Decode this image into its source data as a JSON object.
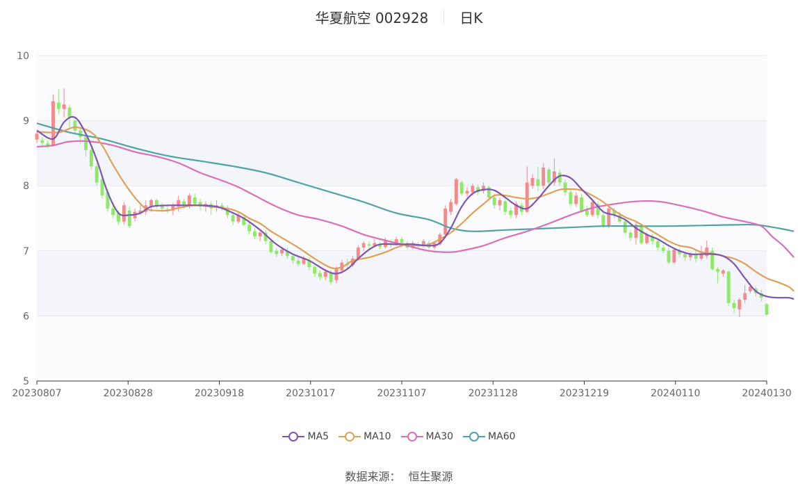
{
  "header": {
    "title": "华夏航空 002928",
    "period": "日K"
  },
  "legend_title": "",
  "source": {
    "label": "数据来源：",
    "value": "恒生聚源"
  },
  "colors": {
    "up": "#f28b8b",
    "down": "#8fe86a",
    "MA5": "#7b55b0",
    "MA10": "#e0a057",
    "MA30": "#d86fb8",
    "MA60": "#4fa3a5",
    "band": "#f3f5fa",
    "grid": "#e4e8f0"
  },
  "chart_data": {
    "type": "candlestick",
    "ylim": [
      5,
      10
    ],
    "yticks": [
      "5",
      "6",
      "7",
      "8",
      "9",
      "10"
    ],
    "x_tick_labels": [
      "20230807",
      "20230828",
      "20230918",
      "20231017",
      "20231107",
      "20231128",
      "20231219",
      "20240110",
      "20240130"
    ],
    "legend": [
      "MA5",
      "MA10",
      "MA30",
      "MA60"
    ],
    "candles": [
      [
        8.71,
        8.8,
        8.66,
        8.84
      ],
      [
        8.7,
        8.66,
        8.62,
        8.75
      ],
      [
        8.65,
        8.62,
        8.58,
        8.7
      ],
      [
        8.62,
        9.3,
        8.6,
        9.4
      ],
      [
        9.28,
        9.18,
        9.1,
        9.48
      ],
      [
        9.18,
        9.25,
        9.05,
        9.5
      ],
      [
        9.2,
        9.05,
        8.9,
        9.25
      ],
      [
        9.0,
        8.85,
        8.8,
        9.05
      ],
      [
        8.85,
        8.75,
        8.65,
        8.9
      ],
      [
        8.75,
        8.55,
        8.45,
        8.8
      ],
      [
        8.55,
        8.3,
        8.25,
        8.6
      ],
      [
        8.3,
        8.05,
        8.0,
        8.35
      ],
      [
        8.1,
        7.85,
        7.8,
        8.15
      ],
      [
        7.9,
        7.65,
        7.6,
        7.95
      ],
      [
        7.65,
        7.55,
        7.5,
        7.7
      ],
      [
        7.58,
        7.45,
        7.4,
        7.62
      ],
      [
        7.45,
        7.7,
        7.4,
        7.75
      ],
      [
        7.62,
        7.38,
        7.35,
        7.68
      ],
      [
        7.5,
        7.6,
        7.45,
        7.65
      ],
      [
        7.58,
        7.62,
        7.55,
        7.7
      ],
      [
        7.6,
        7.7,
        7.55,
        7.78
      ],
      [
        7.68,
        7.78,
        7.6,
        7.8
      ],
      [
        7.78,
        7.68,
        7.65,
        7.8
      ],
      [
        7.7,
        7.65,
        7.6,
        7.74
      ],
      [
        7.64,
        7.62,
        7.58,
        7.7
      ],
      [
        7.62,
        7.7,
        7.55,
        7.74
      ],
      [
        7.68,
        7.78,
        7.6,
        7.85
      ],
      [
        7.76,
        7.7,
        7.65,
        7.8
      ],
      [
        7.7,
        7.85,
        7.65,
        7.88
      ],
      [
        7.82,
        7.72,
        7.68,
        7.88
      ],
      [
        7.75,
        7.68,
        7.62,
        7.8
      ],
      [
        7.68,
        7.72,
        7.6,
        7.76
      ],
      [
        7.72,
        7.65,
        7.55,
        7.76
      ],
      [
        7.66,
        7.7,
        7.6,
        7.78
      ],
      [
        7.7,
        7.66,
        7.62,
        7.74
      ],
      [
        7.66,
        7.55,
        7.5,
        7.7
      ],
      [
        7.55,
        7.45,
        7.4,
        7.6
      ],
      [
        7.45,
        7.55,
        7.42,
        7.6
      ],
      [
        7.52,
        7.4,
        7.38,
        7.56
      ],
      [
        7.4,
        7.3,
        7.25,
        7.45
      ],
      [
        7.3,
        7.22,
        7.18,
        7.35
      ],
      [
        7.22,
        7.28,
        7.15,
        7.32
      ],
      [
        7.28,
        7.15,
        7.1,
        7.32
      ],
      [
        7.15,
        6.98,
        6.95,
        7.18
      ],
      [
        7.0,
        6.95,
        6.9,
        7.05
      ],
      [
        6.96,
        7.02,
        6.92,
        7.06
      ],
      [
        7.0,
        6.92,
        6.88,
        7.05
      ],
      [
        6.92,
        6.85,
        6.8,
        6.95
      ],
      [
        6.85,
        6.8,
        6.76,
        6.9
      ],
      [
        6.8,
        6.88,
        6.78,
        6.92
      ],
      [
        6.86,
        6.75,
        6.7,
        6.9
      ],
      [
        6.75,
        6.65,
        6.6,
        6.78
      ],
      [
        6.66,
        6.6,
        6.55,
        6.7
      ],
      [
        6.6,
        6.68,
        6.55,
        6.72
      ],
      [
        6.66,
        6.52,
        6.48,
        6.7
      ],
      [
        6.55,
        6.72,
        6.5,
        6.76
      ],
      [
        6.7,
        6.82,
        6.65,
        6.86
      ],
      [
        6.8,
        6.78,
        6.72,
        6.88
      ],
      [
        6.78,
        6.88,
        6.75,
        6.92
      ],
      [
        6.88,
        7.05,
        6.85,
        7.08
      ],
      [
        7.05,
        7.12,
        7.0,
        7.15
      ],
      [
        7.1,
        7.08,
        7.02,
        7.15
      ],
      [
        7.08,
        7.12,
        7.05,
        7.18
      ],
      [
        7.1,
        7.06,
        7.02,
        7.14
      ],
      [
        7.06,
        7.15,
        7.04,
        7.2
      ],
      [
        7.12,
        7.1,
        7.05,
        7.18
      ],
      [
        7.1,
        7.18,
        7.08,
        7.22
      ],
      [
        7.18,
        7.12,
        7.08,
        7.22
      ],
      [
        7.12,
        7.05,
        7.02,
        7.15
      ],
      [
        7.05,
        7.12,
        7.02,
        7.15
      ],
      [
        7.1,
        7.08,
        7.04,
        7.14
      ],
      [
        7.08,
        7.15,
        7.05,
        7.18
      ],
      [
        7.12,
        7.05,
        7.02,
        7.16
      ],
      [
        7.05,
        7.12,
        7.02,
        7.15
      ],
      [
        7.1,
        7.25,
        7.08,
        7.28
      ],
      [
        7.25,
        7.65,
        7.2,
        7.7
      ],
      [
        7.6,
        7.75,
        7.55,
        7.8
      ],
      [
        7.72,
        8.1,
        7.7,
        8.12
      ],
      [
        8.05,
        7.88,
        7.85,
        8.08
      ],
      [
        7.88,
        7.92,
        7.82,
        7.98
      ],
      [
        7.9,
        8.0,
        7.85,
        8.04
      ],
      [
        7.98,
        7.9,
        7.85,
        8.02
      ],
      [
        7.92,
        8.0,
        7.88,
        8.05
      ],
      [
        7.98,
        7.82,
        7.78,
        8.0
      ],
      [
        7.82,
        7.7,
        7.65,
        7.88
      ],
      [
        7.7,
        7.78,
        7.62,
        7.82
      ],
      [
        7.76,
        7.6,
        7.55,
        7.8
      ],
      [
        7.62,
        7.55,
        7.5,
        7.66
      ],
      [
        7.55,
        7.72,
        7.5,
        7.76
      ],
      [
        7.7,
        7.6,
        7.55,
        7.74
      ],
      [
        7.6,
        8.05,
        7.58,
        8.3
      ],
      [
        8.0,
        8.12,
        7.95,
        8.18
      ],
      [
        8.1,
        8.0,
        7.92,
        8.3
      ],
      [
        8.0,
        8.28,
        7.95,
        8.35
      ],
      [
        8.25,
        8.05,
        8.0,
        8.28
      ],
      [
        8.05,
        8.22,
        8.0,
        8.42
      ],
      [
        8.2,
        8.05,
        8.0,
        8.25
      ],
      [
        8.05,
        7.9,
        7.85,
        8.1
      ],
      [
        7.9,
        7.72,
        7.68,
        7.95
      ],
      [
        7.72,
        7.85,
        7.68,
        7.9
      ],
      [
        7.82,
        7.62,
        7.58,
        7.88
      ],
      [
        7.62,
        7.55,
        7.52,
        7.7
      ],
      [
        7.55,
        7.75,
        7.52,
        7.78
      ],
      [
        7.72,
        7.55,
        7.5,
        7.76
      ],
      [
        7.55,
        7.38,
        7.35,
        7.6
      ],
      [
        7.38,
        7.65,
        7.35,
        7.7
      ],
      [
        7.62,
        7.55,
        7.5,
        7.66
      ],
      [
        7.55,
        7.45,
        7.42,
        7.6
      ],
      [
        7.45,
        7.28,
        7.25,
        7.5
      ],
      [
        7.28,
        7.2,
        7.15,
        7.32
      ],
      [
        7.2,
        7.4,
        7.1,
        7.44
      ],
      [
        7.38,
        7.12,
        7.1,
        7.42
      ],
      [
        7.12,
        7.25,
        7.1,
        7.28
      ],
      [
        7.22,
        7.15,
        7.1,
        7.26
      ],
      [
        7.15,
        7.05,
        7.0,
        7.18
      ],
      [
        7.05,
        7.0,
        6.96,
        7.1
      ],
      [
        7.0,
        6.82,
        6.8,
        7.05
      ],
      [
        6.82,
        7.02,
        6.8,
        7.05
      ],
      [
        7.0,
        6.95,
        6.9,
        7.04
      ],
      [
        6.95,
        6.9,
        6.85,
        6.98
      ],
      [
        6.9,
        6.95,
        6.85,
        6.98
      ],
      [
        6.95,
        6.88,
        6.82,
        7.0
      ],
      [
        6.88,
        6.95,
        6.85,
        7.08
      ],
      [
        6.92,
        7.05,
        6.88,
        7.16
      ],
      [
        7.0,
        6.72,
        6.7,
        7.05
      ],
      [
        6.72,
        6.68,
        6.5,
        6.75
      ],
      [
        6.65,
        6.7,
        6.6,
        6.72
      ],
      [
        6.68,
        6.2,
        6.15,
        6.7
      ],
      [
        6.2,
        6.12,
        6.05,
        6.25
      ],
      [
        6.1,
        6.25,
        5.98,
        6.28
      ],
      [
        6.25,
        6.35,
        6.2,
        6.48
      ],
      [
        6.38,
        6.45,
        6.35,
        6.5
      ],
      [
        6.42,
        6.35,
        6.3,
        6.45
      ],
      [
        6.35,
        6.28,
        6.22,
        6.4
      ],
      [
        6.18,
        6.02,
        6.0,
        6.2
      ]
    ],
    "MA5": [
      [
        0,
        8.85
      ],
      [
        3,
        8.72
      ],
      [
        5,
        8.98
      ],
      [
        7,
        9.05
      ],
      [
        9,
        8.8
      ],
      [
        11,
        8.4
      ],
      [
        13,
        7.9
      ],
      [
        15,
        7.58
      ],
      [
        17,
        7.55
      ],
      [
        19,
        7.58
      ],
      [
        21,
        7.68
      ],
      [
        24,
        7.7
      ],
      [
        27,
        7.7
      ],
      [
        30,
        7.7
      ],
      [
        33,
        7.68
      ],
      [
        35,
        7.62
      ],
      [
        38,
        7.5
      ],
      [
        41,
        7.32
      ],
      [
        44,
        7.1
      ],
      [
        47,
        6.95
      ],
      [
        50,
        6.85
      ],
      [
        53,
        6.7
      ],
      [
        55,
        6.65
      ],
      [
        57,
        6.72
      ],
      [
        59,
        6.88
      ],
      [
        61,
        7.02
      ],
      [
        63,
        7.1
      ],
      [
        66,
        7.1
      ],
      [
        69,
        7.1
      ],
      [
        72,
        7.08
      ],
      [
        74,
        7.12
      ],
      [
        76,
        7.35
      ],
      [
        78,
        7.68
      ],
      [
        80,
        7.88
      ],
      [
        82,
        7.94
      ],
      [
        84,
        7.93
      ],
      [
        86,
        7.82
      ],
      [
        88,
        7.7
      ],
      [
        90,
        7.65
      ],
      [
        92,
        7.8
      ],
      [
        94,
        8.0
      ],
      [
        96,
        8.15
      ],
      [
        98,
        8.12
      ],
      [
        100,
        7.95
      ],
      [
        102,
        7.78
      ],
      [
        104,
        7.6
      ],
      [
        106,
        7.55
      ],
      [
        108,
        7.48
      ],
      [
        110,
        7.35
      ],
      [
        112,
        7.25
      ],
      [
        114,
        7.18
      ],
      [
        116,
        7.08
      ],
      [
        118,
        7.0
      ],
      [
        120,
        6.95
      ],
      [
        122,
        6.95
      ],
      [
        124,
        6.95
      ],
      [
        126,
        6.92
      ],
      [
        128,
        6.8
      ],
      [
        130,
        6.58
      ],
      [
        132,
        6.38
      ],
      [
        134,
        6.3
      ],
      [
        136,
        6.28
      ],
      [
        138,
        6.28
      ],
      [
        139,
        6.26
      ]
    ],
    "MA10": [
      [
        0,
        8.83
      ],
      [
        4,
        8.82
      ],
      [
        7,
        8.9
      ],
      [
        10,
        8.82
      ],
      [
        12,
        8.62
      ],
      [
        14,
        8.32
      ],
      [
        16,
        8.05
      ],
      [
        18,
        7.82
      ],
      [
        20,
        7.65
      ],
      [
        22,
        7.62
      ],
      [
        24,
        7.62
      ],
      [
        26,
        7.66
      ],
      [
        29,
        7.7
      ],
      [
        32,
        7.68
      ],
      [
        35,
        7.65
      ],
      [
        37,
        7.6
      ],
      [
        39,
        7.5
      ],
      [
        41,
        7.42
      ],
      [
        43,
        7.3
      ],
      [
        45,
        7.2
      ],
      [
        48,
        7.05
      ],
      [
        51,
        6.88
      ],
      [
        54,
        6.74
      ],
      [
        56,
        6.75
      ],
      [
        58,
        6.85
      ],
      [
        61,
        6.9
      ],
      [
        64,
        6.98
      ],
      [
        66,
        7.05
      ],
      [
        68,
        7.1
      ],
      [
        70,
        7.08
      ],
      [
        72,
        7.1
      ],
      [
        74,
        7.18
      ],
      [
        76,
        7.28
      ],
      [
        78,
        7.42
      ],
      [
        80,
        7.58
      ],
      [
        82,
        7.72
      ],
      [
        84,
        7.85
      ],
      [
        86,
        7.85
      ],
      [
        88,
        7.82
      ],
      [
        90,
        7.8
      ],
      [
        92,
        7.82
      ],
      [
        94,
        7.88
      ],
      [
        96,
        7.94
      ],
      [
        98,
        7.95
      ],
      [
        100,
        7.93
      ],
      [
        102,
        7.85
      ],
      [
        104,
        7.75
      ],
      [
        106,
        7.62
      ],
      [
        108,
        7.52
      ],
      [
        110,
        7.45
      ],
      [
        112,
        7.35
      ],
      [
        114,
        7.25
      ],
      [
        116,
        7.15
      ],
      [
        118,
        7.08
      ],
      [
        120,
        7.05
      ],
      [
        122,
        6.98
      ],
      [
        124,
        6.96
      ],
      [
        126,
        6.92
      ],
      [
        128,
        6.88
      ],
      [
        130,
        6.8
      ],
      [
        132,
        6.68
      ],
      [
        134,
        6.58
      ],
      [
        136,
        6.52
      ],
      [
        138,
        6.45
      ],
      [
        139,
        6.38
      ]
    ],
    "MA30": [
      [
        0,
        8.6
      ],
      [
        3,
        8.62
      ],
      [
        6,
        8.68
      ],
      [
        10,
        8.68
      ],
      [
        14,
        8.62
      ],
      [
        18,
        8.52
      ],
      [
        22,
        8.45
      ],
      [
        26,
        8.35
      ],
      [
        30,
        8.2
      ],
      [
        34,
        8.08
      ],
      [
        37,
        7.98
      ],
      [
        40,
        7.85
      ],
      [
        44,
        7.68
      ],
      [
        48,
        7.55
      ],
      [
        52,
        7.48
      ],
      [
        56,
        7.38
      ],
      [
        60,
        7.25
      ],
      [
        64,
        7.16
      ],
      [
        68,
        7.08
      ],
      [
        72,
        7.0
      ],
      [
        76,
        6.98
      ],
      [
        79,
        7.02
      ],
      [
        82,
        7.08
      ],
      [
        86,
        7.2
      ],
      [
        90,
        7.3
      ],
      [
        94,
        7.42
      ],
      [
        98,
        7.55
      ],
      [
        102,
        7.66
      ],
      [
        106,
        7.72
      ],
      [
        110,
        7.76
      ],
      [
        114,
        7.76
      ],
      [
        118,
        7.7
      ],
      [
        122,
        7.62
      ],
      [
        126,
        7.52
      ],
      [
        130,
        7.45
      ],
      [
        133,
        7.38
      ],
      [
        135,
        7.22
      ],
      [
        137,
        7.08
      ],
      [
        139,
        6.9
      ]
    ],
    "MA60": [
      [
        0,
        8.96
      ],
      [
        6,
        8.82
      ],
      [
        12,
        8.72
      ],
      [
        18,
        8.58
      ],
      [
        24,
        8.46
      ],
      [
        30,
        8.38
      ],
      [
        36,
        8.3
      ],
      [
        42,
        8.2
      ],
      [
        48,
        8.05
      ],
      [
        54,
        7.9
      ],
      [
        60,
        7.75
      ],
      [
        66,
        7.58
      ],
      [
        72,
        7.48
      ],
      [
        76,
        7.35
      ],
      [
        80,
        7.3
      ],
      [
        86,
        7.32
      ],
      [
        92,
        7.34
      ],
      [
        98,
        7.36
      ],
      [
        104,
        7.38
      ],
      [
        110,
        7.38
      ],
      [
        116,
        7.38
      ],
      [
        122,
        7.39
      ],
      [
        128,
        7.4
      ],
      [
        132,
        7.4
      ],
      [
        136,
        7.35
      ],
      [
        139,
        7.3
      ]
    ]
  }
}
